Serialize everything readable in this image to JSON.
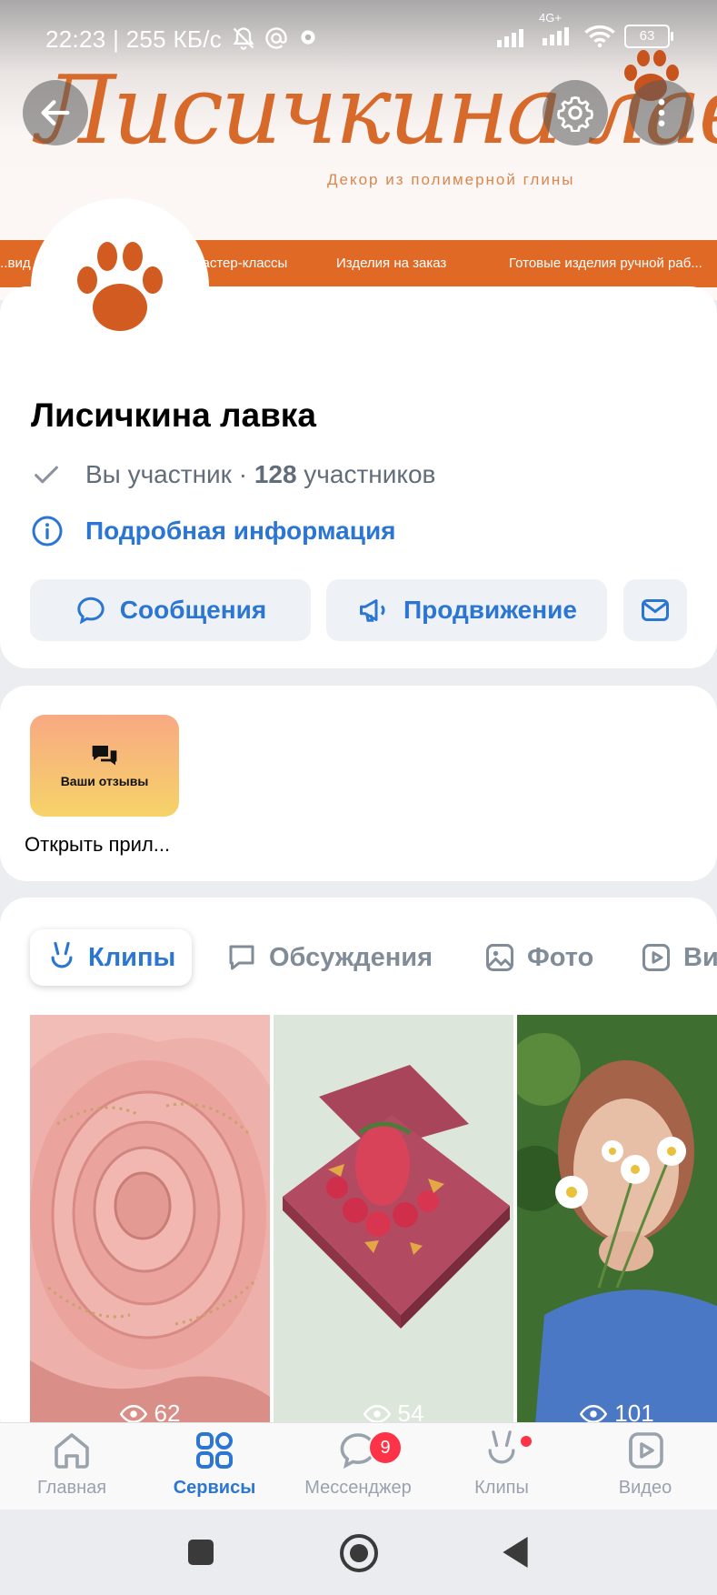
{
  "status_bar": {
    "time_speed": "22:23 | 255 КБ/с",
    "network_label": "4G+",
    "battery": "63"
  },
  "cover": {
    "logo_text": "Лисичкина лавка",
    "logo_subtitle": "Декор из полимерной глины",
    "menu": [
      "...вид",
      "...астер-классы",
      "Изделия на заказ",
      "Готовые изделия ручной раб..."
    ]
  },
  "header_buttons": {
    "back": "back-icon",
    "settings": "gear-icon",
    "more": "more-vertical-icon"
  },
  "group": {
    "title": "Лисичкина лавка",
    "member_status": "Вы участник · ",
    "member_count": "128",
    "member_suffix": " участников",
    "details_link": "Подробная информация"
  },
  "actions": {
    "messages": "Сообщения",
    "promotion": "Продвижение"
  },
  "app": {
    "tile_label": "Ваши отзывы",
    "caption": "Открыть прил..."
  },
  "tabs": [
    {
      "label": "Клипы",
      "icon": "clips-icon",
      "active": true
    },
    {
      "label": "Обсуждения",
      "icon": "discussion-icon",
      "active": false
    },
    {
      "label": "Фото",
      "icon": "photo-icon",
      "active": false
    },
    {
      "label": "Ви...",
      "icon": "video-icon",
      "active": false
    }
  ],
  "clips": [
    {
      "views": "62",
      "subject": "pink polymer clay peony flower"
    },
    {
      "views": "54",
      "subject": "raspberry decorated pink clay block"
    },
    {
      "views": "101",
      "subject": "girl holding daisies"
    }
  ],
  "bottom_nav": [
    {
      "label": "Главная",
      "icon": "home-icon",
      "active": false
    },
    {
      "label": "Сервисы",
      "icon": "services-icon",
      "active": true
    },
    {
      "label": "Мессенджер",
      "icon": "messenger-icon",
      "active": false,
      "badge": "9"
    },
    {
      "label": "Клипы",
      "icon": "clips-icon",
      "active": false,
      "dot": true
    },
    {
      "label": "Видео",
      "icon": "video-icon",
      "active": false
    }
  ],
  "colors": {
    "accent": "#2b76d3",
    "brand_orange": "#e06a25",
    "badge_red": "#ff3347",
    "secondary_text": "#626d7a"
  }
}
